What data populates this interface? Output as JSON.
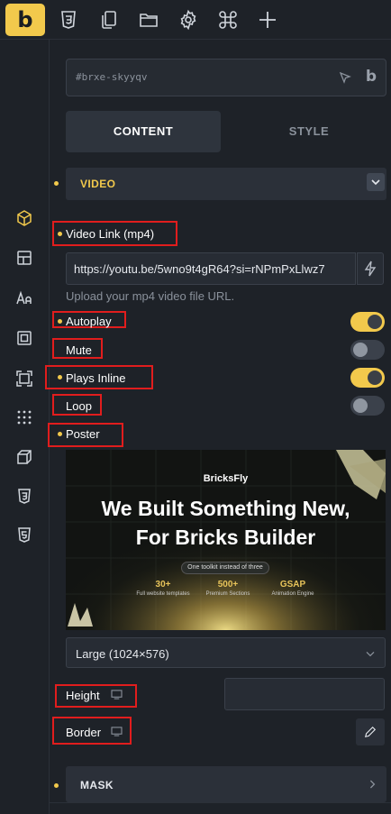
{
  "topbar": {
    "logo": "b",
    "icons": [
      "css3-icon",
      "pages-icon",
      "folder-icon",
      "settings-gear-icon",
      "command-icon",
      "plus-icon"
    ]
  },
  "rail": {
    "icons": [
      "cube-icon",
      "layout-icon",
      "typography-icon",
      "spacing-icon",
      "sizing-icon",
      "grid-dots-icon",
      "box-3d-icon",
      "css3-shield-icon",
      "html5-shield-icon"
    ]
  },
  "element_id": "#brxe-skyyqv",
  "tabs": {
    "content": "CONTENT",
    "style": "STYLE"
  },
  "video_section": {
    "title": "VIDEO"
  },
  "video_link": {
    "label": "Video Link (mp4)",
    "value": "https://youtu.be/5wno9t4gR64?si=rNPmPxLlwz7",
    "hint": "Upload your mp4 video file URL."
  },
  "toggles": {
    "autoplay": {
      "label": "Autoplay",
      "on": true
    },
    "mute": {
      "label": "Mute",
      "on": false
    },
    "plays_inline": {
      "label": "Plays Inline",
      "on": true
    },
    "loop": {
      "label": "Loop",
      "on": false
    }
  },
  "poster": {
    "label": "Poster",
    "brand": "BricksFly",
    "headline_1": "We Built Something New,",
    "headline_2": "For Bricks Builder",
    "pill": "One toolkit instead of three",
    "stats": [
      {
        "num": "30+",
        "text": "Full website templates"
      },
      {
        "num": "500+",
        "text": "Premium Sections"
      },
      {
        "num": "GSAP",
        "text": "Animation Engine"
      }
    ],
    "size_select": "Large (1024×576)"
  },
  "height": {
    "label": "Height"
  },
  "border": {
    "label": "Border"
  },
  "mask_section": {
    "title": "MASK"
  },
  "colors": {
    "accent": "#f2c94c",
    "highlight": "#e11d1d",
    "bg": "#1e2228"
  }
}
